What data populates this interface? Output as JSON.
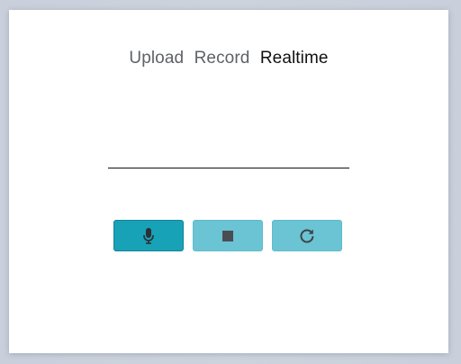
{
  "tabs": [
    {
      "label": "Upload",
      "active": false
    },
    {
      "label": "Record",
      "active": false
    },
    {
      "label": "Realtime",
      "active": true
    }
  ],
  "transcript": {
    "text": ""
  },
  "controls": {
    "record": {
      "icon": "microphone-icon",
      "enabled": true
    },
    "stop": {
      "icon": "stop-icon",
      "enabled": false
    },
    "reset": {
      "icon": "refresh-icon",
      "enabled": false
    }
  },
  "colors": {
    "primary": "#17a2b8",
    "primary_disabled": "#6ac4d3",
    "icon": "#2b2f33",
    "background": "#ccd3dd",
    "card": "#ffffff"
  }
}
